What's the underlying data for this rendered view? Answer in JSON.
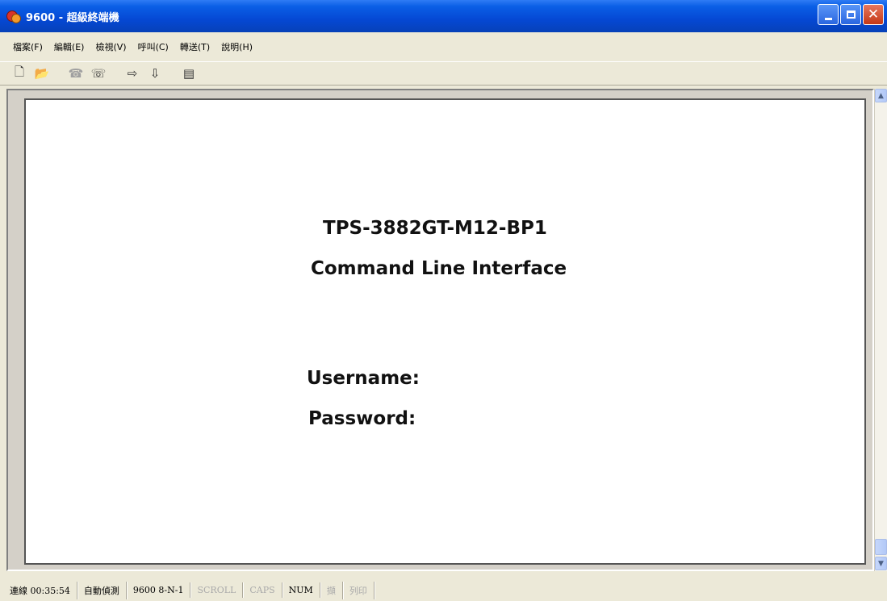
{
  "window": {
    "title": "9600 - 超級終端機",
    "controls": {
      "minimize_icon": "minimize-icon",
      "maximize_icon": "maximize-icon",
      "close_icon": "close-icon"
    }
  },
  "menu": {
    "items": [
      {
        "label": "檔案(F)"
      },
      {
        "label": "編輯(E)"
      },
      {
        "label": "檢視(V)"
      },
      {
        "label": "呼叫(C)"
      },
      {
        "label": "轉送(T)"
      },
      {
        "label": "說明(H)"
      }
    ]
  },
  "toolbar": {
    "icons": [
      "new-file-icon",
      "open-folder-icon",
      "connect-phone-icon",
      "disconnect-icon",
      "send-file-icon",
      "receive-file-icon",
      "properties-icon"
    ]
  },
  "terminal": {
    "device_name": "TPS-3882GT-M12-BP1",
    "subtitle": "Command Line Interface",
    "username_label": "Username:",
    "password_label": "Password:"
  },
  "statusbar": {
    "cells": [
      {
        "text": "連線 00:35:54",
        "active": true
      },
      {
        "text": "自動偵測",
        "active": true
      },
      {
        "text": "9600 8-N-1",
        "active": true
      },
      {
        "text": "SCROLL",
        "active": false
      },
      {
        "text": "CAPS",
        "active": false
      },
      {
        "text": "NUM",
        "active": true
      },
      {
        "text": "擷",
        "active": false
      },
      {
        "text": "列印",
        "active": false
      }
    ]
  }
}
